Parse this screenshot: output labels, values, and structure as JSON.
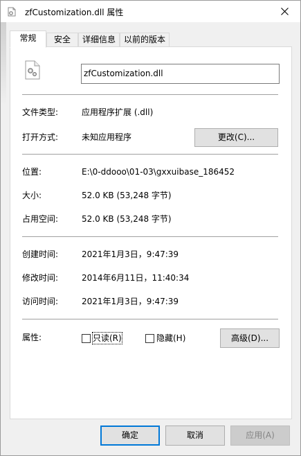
{
  "window": {
    "title": "zfCustomization.dll 属性"
  },
  "tabs": [
    {
      "label": "常规"
    },
    {
      "label": "安全"
    },
    {
      "label": "详细信息"
    },
    {
      "label": "以前的版本"
    }
  ],
  "file": {
    "name": "zfCustomization.dll",
    "icon": "dll-gear-file-icon"
  },
  "info": {
    "type_label": "文件类型:",
    "type_value": "应用程序扩展 (.dll)",
    "opens_label": "打开方式:",
    "opens_value": "未知应用程序",
    "change_button": "更改(C)...",
    "location_label": "位置:",
    "location_value": "E:\\0-ddooo\\01-03\\gxxuibase_186452",
    "size_label": "大小:",
    "size_value": "52.0 KB (53,248 字节)",
    "disk_label": "占用空间:",
    "disk_value": "52.0 KB (53,248 字节)",
    "created_label": "创建时间:",
    "created_value": "2021年1月3日，9:47:39",
    "modified_label": "修改时间:",
    "modified_value": "2014年6月11日，11:40:34",
    "accessed_label": "访问时间:",
    "accessed_value": "2021年1月3日，9:47:39"
  },
  "attributes": {
    "label": "属性:",
    "readonly_label": "只读(R)",
    "readonly_checked": false,
    "hidden_label": "隐藏(H)",
    "hidden_checked": false,
    "advanced_button": "高级(D)..."
  },
  "footer": {
    "ok": "确定",
    "cancel": "取消",
    "apply": "应用(A)"
  },
  "colors": {
    "accent": "#0078d7",
    "window_bg": "#f0f0f0",
    "panel_bg": "#ffffff"
  }
}
